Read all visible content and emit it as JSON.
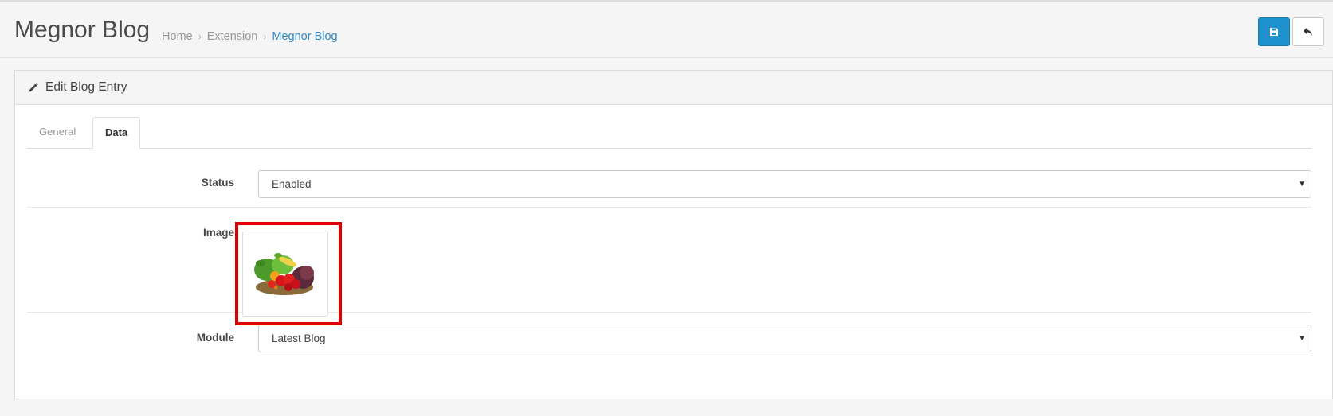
{
  "header": {
    "title": "Megnor Blog",
    "breadcrumb": [
      "Home",
      "Extension",
      "Megnor Blog"
    ],
    "breadcrumb_separator": "›",
    "save_icon": "save-icon",
    "back_icon": "reply-icon"
  },
  "panel": {
    "title": "Edit Blog Entry",
    "icon": "pencil-icon"
  },
  "tabs": [
    {
      "label": "General",
      "active": false
    },
    {
      "label": "Data",
      "active": true
    }
  ],
  "form": {
    "status": {
      "label": "Status",
      "value": "Enabled"
    },
    "image": {
      "label": "Image",
      "alt": "vegetables-basket-image"
    },
    "module": {
      "label": "Module",
      "value": "Latest Blog"
    }
  },
  "colors": {
    "primary": "#1e91cf",
    "link": "#2f89c5",
    "highlight": "#e00000"
  }
}
